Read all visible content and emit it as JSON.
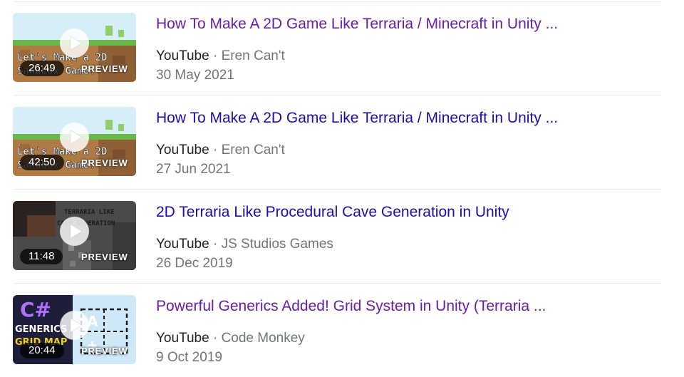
{
  "results": [
    {
      "title": "How To Make A 2D Game Like Terraria / Minecraft in Unity ...",
      "source": "YouTube",
      "separator": "·",
      "channel": "Eren Can't",
      "date": "30 May 2021",
      "duration": "26:49",
      "preview_label": "PREVIEW",
      "thumb_text_1": "Let's Make a 2D",
      "thumb_text_2": "Sandbox Game!",
      "visited": true
    },
    {
      "title": "How To Make A 2D Game Like Terraria / Minecraft in Unity ...",
      "source": "YouTube",
      "separator": "·",
      "channel": "Eren Can't",
      "date": "27 Jun 2021",
      "duration": "42:50",
      "preview_label": "PREVIEW",
      "thumb_text_1": "Let's Make a 2D",
      "thumb_text_2": "Sandbox Game!",
      "visited": false
    },
    {
      "title": "2D Terraria Like Procedural Cave Generation in Unity",
      "source": "YouTube",
      "separator": "·",
      "channel": "JS Studios Games",
      "date": "26 Dec 2019",
      "duration": "11:48",
      "preview_label": "PREVIEW",
      "thumb_text_1": "TERRARIA LIKE",
      "thumb_text_2": "CAVE GENERATION",
      "visited": false
    },
    {
      "title": "Powerful Generics Added! Grid System in Unity (Terraria ...",
      "source": "YouTube",
      "separator": "·",
      "channel": "Code Monkey",
      "date": "9 Oct 2019",
      "duration": "20:44",
      "preview_label": "PREVIEW",
      "thumb_text_1": "C#",
      "thumb_text_2": "GENERICS",
      "thumb_text_3": "GRID MAP",
      "visited": true
    }
  ],
  "colors": {
    "visited_link": "#681da8",
    "unvisited_link": "#1a0dab",
    "secondary_text": "#70757a",
    "primary_text": "#202124"
  },
  "icons": {
    "play": "play-icon"
  }
}
